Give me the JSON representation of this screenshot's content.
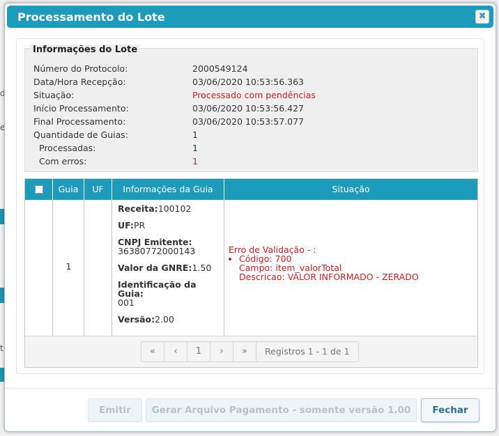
{
  "dialog": {
    "title": "Processamento do Lote",
    "close_icon": "close-icon"
  },
  "background": {
    "chars": [
      "d",
      "e",
      "t"
    ]
  },
  "lote_info": {
    "legend": "Informações do Lote",
    "rows": [
      {
        "label": "Número do Protocolo:",
        "value": "2000549124"
      },
      {
        "label": "Data/Hora Recepção:",
        "value": "03/06/2020 10:53:56.363"
      },
      {
        "label": "Situação:",
        "value": "Processado com pendências"
      },
      {
        "label": "Início Processamento:",
        "value": "03/06/2020 10:53:56.427"
      },
      {
        "label": "Final Processamento:",
        "value": "03/06/2020 10:53:57.077"
      },
      {
        "label": "Quantidade de Guias:",
        "value": "1"
      },
      {
        "label": "Processadas:",
        "value": "1"
      },
      {
        "label": "Com erros:",
        "value": "1"
      }
    ]
  },
  "grid": {
    "headers": [
      "Guia",
      "UF",
      "Informações da Guia",
      "Situação"
    ],
    "row": {
      "guia": "1",
      "uf": "",
      "receita_label": "Receita:",
      "receita_value": "100102",
      "uf_label": "UF:",
      "uf_value": "PR",
      "cnpj_label": "CNPJ Emitente:",
      "cnpj_value": "36380772000143",
      "valor_label": "Valor da GNRE:",
      "valor_value": "1.50",
      "ident_label": "Identificação da Guia:",
      "ident_value": "001",
      "versao_label": "Versão:",
      "versao_value": "2.00",
      "erro_title": "Erro de Validação - :",
      "erro_codigo": "Código: 700",
      "erro_campo": "Campo: item_valorTotal",
      "erro_descricao": "Descricao: VALOR INFORMADO - ZERADO"
    }
  },
  "pager": {
    "first": "«",
    "prev": "‹",
    "page": "1",
    "next": "›",
    "last": "»",
    "info": "Registros 1 - 1 de 1"
  },
  "footer": {
    "emitir": "Emitir",
    "gerar": "Gerar Arquivo Pagamento - somente versão 1.00",
    "fechar": "Fechar"
  },
  "colors": {
    "accent": "#1c9bbb",
    "error": "#cc1f1f"
  }
}
